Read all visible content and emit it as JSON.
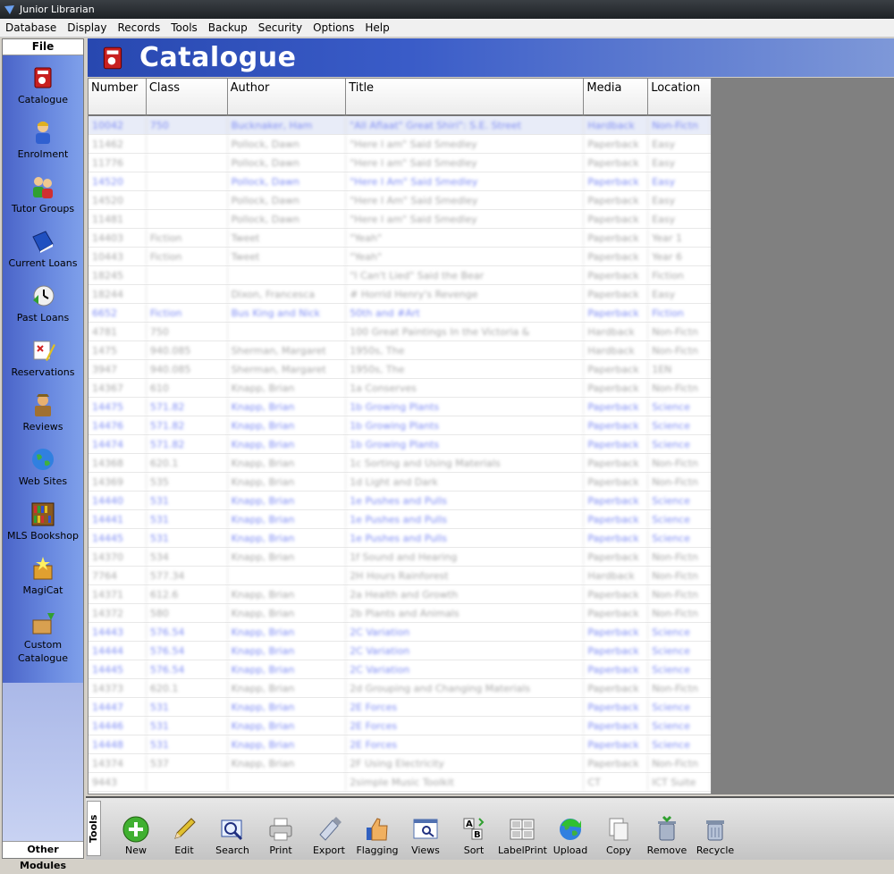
{
  "window": {
    "title": "Junior Librarian"
  },
  "menu": [
    "Database",
    "Display",
    "Records",
    "Tools",
    "Backup",
    "Security",
    "Options",
    "Help"
  ],
  "sidebar": {
    "header": "File",
    "items": [
      {
        "label": "Catalogue",
        "icon": "book-icon"
      },
      {
        "label": "Enrolment",
        "icon": "student-icon"
      },
      {
        "label": "Tutor Groups",
        "icon": "group-icon"
      },
      {
        "label": "Current Loans",
        "icon": "blue-book-icon"
      },
      {
        "label": "Past Loans",
        "icon": "clock-icon"
      },
      {
        "label": "Reservations",
        "icon": "pencil-note-icon"
      },
      {
        "label": "Reviews",
        "icon": "reviewer-icon"
      },
      {
        "label": "Web Sites",
        "icon": "globe-icon"
      },
      {
        "label": "MLS Bookshop",
        "icon": "bookshelf-icon"
      },
      {
        "label": "MagiCat",
        "icon": "magic-box-icon"
      },
      {
        "label": "Custom Catalogue",
        "icon": "custom-box-icon"
      }
    ],
    "footer": "Other Modules"
  },
  "page": {
    "title": "Catalogue"
  },
  "table": {
    "columns": [
      "Number",
      "Class",
      "Author",
      "Title",
      "Media",
      "Location"
    ],
    "rows": [
      {
        "cells": [
          "10042",
          "750",
          "Bucknaker, Ham",
          "\"All Aflaat\" Great Shiri\": S.E. Street",
          "Hardback",
          "Non-Fictn"
        ],
        "hl": true,
        "first": true
      },
      {
        "cells": [
          "11462",
          "",
          "Pollock, Dawn",
          "\"Here I am\" Said Smedley",
          "Paperback",
          "Easy"
        ]
      },
      {
        "cells": [
          "11776",
          "",
          "Pollock, Dawn",
          "\"Here I am\" Said Smedley",
          "Paperback",
          "Easy"
        ]
      },
      {
        "cells": [
          "14520",
          "",
          "Pollock, Dawn",
          "\"Here I Am\" Said Smedley",
          "Paperback",
          "Easy"
        ],
        "hl": true
      },
      {
        "cells": [
          "14520",
          "",
          "Pollock, Dawn",
          "\"Here I Am\" Said Smedley",
          "Paperback",
          "Easy"
        ]
      },
      {
        "cells": [
          "11481",
          "",
          "Pollock, Dawn",
          "\"Here I am\" Said Smedley",
          "Paperback",
          "Easy"
        ]
      },
      {
        "cells": [
          "14403",
          "Fiction",
          "Tweet",
          "\"Yeah\"",
          "Paperback",
          "Year 1"
        ]
      },
      {
        "cells": [
          "10443",
          "Fiction",
          "Tweet",
          "\"Yeah\"",
          "Paperback",
          "Year 6"
        ]
      },
      {
        "cells": [
          "18245",
          "",
          "",
          "\"I Can't Lied\" Said the Bear",
          "Paperback",
          "Fiction"
        ]
      },
      {
        "cells": [
          "18244",
          "",
          "Dixon, Francesca",
          "# Horrid Henry's Revenge",
          "Paperback",
          "Easy"
        ]
      },
      {
        "cells": [
          "6652",
          "Fiction",
          "Bus King and Nick",
          "50th and #Art",
          "Paperback",
          "Fiction"
        ],
        "hl": true
      },
      {
        "cells": [
          "4781",
          "750",
          "",
          "100 Great Paintings In the Victoria &",
          "Hardback",
          "Non-Fictn"
        ]
      },
      {
        "cells": [
          "1475",
          "940.085",
          "Sherman, Margaret",
          "1950s, The",
          "Hardback",
          "Non-Fictn"
        ]
      },
      {
        "cells": [
          "3947",
          "940.085",
          "Sherman, Margaret",
          "1950s, The",
          "Paperback",
          "1EN"
        ]
      },
      {
        "cells": [
          "14367",
          "610",
          "Knapp, Brian",
          "1a Conserves",
          "Paperback",
          "Non-Fictn"
        ]
      },
      {
        "cells": [
          "14475",
          "571.82",
          "Knapp, Brian",
          "1b Growing Plants",
          "Paperback",
          "Science"
        ],
        "hl": true
      },
      {
        "cells": [
          "14476",
          "571.82",
          "Knapp, Brian",
          "1b Growing Plants",
          "Paperback",
          "Science"
        ],
        "hl": true
      },
      {
        "cells": [
          "14474",
          "571.82",
          "Knapp, Brian",
          "1b Growing Plants",
          "Paperback",
          "Science"
        ],
        "hl": true
      },
      {
        "cells": [
          "14368",
          "620.1",
          "Knapp, Brian",
          "1c Sorting and Using Materials",
          "Paperback",
          "Non-Fictn"
        ]
      },
      {
        "cells": [
          "14369",
          "535",
          "Knapp, Brian",
          "1d Light and Dark",
          "Paperback",
          "Non-Fictn"
        ]
      },
      {
        "cells": [
          "14440",
          "531",
          "Knapp, Brian",
          "1e Pushes and Pulls",
          "Paperback",
          "Science"
        ],
        "hl": true
      },
      {
        "cells": [
          "14441",
          "531",
          "Knapp, Brian",
          "1e Pushes and Pulls",
          "Paperback",
          "Science"
        ],
        "hl": true
      },
      {
        "cells": [
          "14445",
          "531",
          "Knapp, Brian",
          "1e Pushes and Pulls",
          "Paperback",
          "Science"
        ],
        "hl": true
      },
      {
        "cells": [
          "14370",
          "534",
          "Knapp, Brian",
          "1f Sound and Hearing",
          "Paperback",
          "Non-Fictn"
        ]
      },
      {
        "cells": [
          "7764",
          "577.34",
          "",
          "2H Hours Rainforest",
          "Hardback",
          "Non-Fictn"
        ]
      },
      {
        "cells": [
          "14371",
          "612.6",
          "Knapp, Brian",
          "2a Health and Growth",
          "Paperback",
          "Non-Fictn"
        ]
      },
      {
        "cells": [
          "14372",
          "580",
          "Knapp, Brian",
          "2b Plants and Animals",
          "Paperback",
          "Non-Fictn"
        ]
      },
      {
        "cells": [
          "14443",
          "576.54",
          "Knapp, Brian",
          "2C Variation",
          "Paperback",
          "Science"
        ],
        "hl": true
      },
      {
        "cells": [
          "14444",
          "576.54",
          "Knapp, Brian",
          "2C Variation",
          "Paperback",
          "Science"
        ],
        "hl": true
      },
      {
        "cells": [
          "14445",
          "576.54",
          "Knapp, Brian",
          "2C Variation",
          "Paperback",
          "Science"
        ],
        "hl": true
      },
      {
        "cells": [
          "14373",
          "620.1",
          "Knapp, Brian",
          "2d Grouping and Changing Materials",
          "Paperback",
          "Non-Fictn"
        ]
      },
      {
        "cells": [
          "14447",
          "531",
          "Knapp, Brian",
          "2E Forces",
          "Paperback",
          "Science"
        ],
        "hl": true
      },
      {
        "cells": [
          "14446",
          "531",
          "Knapp, Brian",
          "2E Forces",
          "Paperback",
          "Science"
        ],
        "hl": true
      },
      {
        "cells": [
          "14448",
          "531",
          "Knapp, Brian",
          "2E Forces",
          "Paperback",
          "Science"
        ],
        "hl": true
      },
      {
        "cells": [
          "14374",
          "537",
          "Knapp, Brian",
          "2F Using Electricity",
          "Paperback",
          "Non-Fictn"
        ]
      },
      {
        "cells": [
          "9443",
          "",
          "",
          "2simple Music Toolkit",
          "CT",
          "ICT Suite"
        ]
      }
    ]
  },
  "toolbar": {
    "label": "Tools",
    "buttons": [
      {
        "label": "New",
        "icon": "plus-icon"
      },
      {
        "label": "Edit",
        "icon": "pencil-icon"
      },
      {
        "label": "Search",
        "icon": "search-icon"
      },
      {
        "label": "Print",
        "icon": "printer-icon"
      },
      {
        "label": "Export",
        "icon": "usb-drive-icon"
      },
      {
        "label": "Flagging",
        "icon": "thumbs-up-icon"
      },
      {
        "label": "Views",
        "icon": "views-icon"
      },
      {
        "label": "Sort",
        "icon": "sort-icon"
      },
      {
        "label": "LabelPrint",
        "icon": "label-grid-icon"
      },
      {
        "label": "Upload",
        "icon": "upload-globe-icon"
      },
      {
        "label": "Copy",
        "icon": "copy-icon"
      },
      {
        "label": "Remove",
        "icon": "remove-bin-icon"
      },
      {
        "label": "Recycle",
        "icon": "recycle-bin-icon"
      }
    ]
  }
}
